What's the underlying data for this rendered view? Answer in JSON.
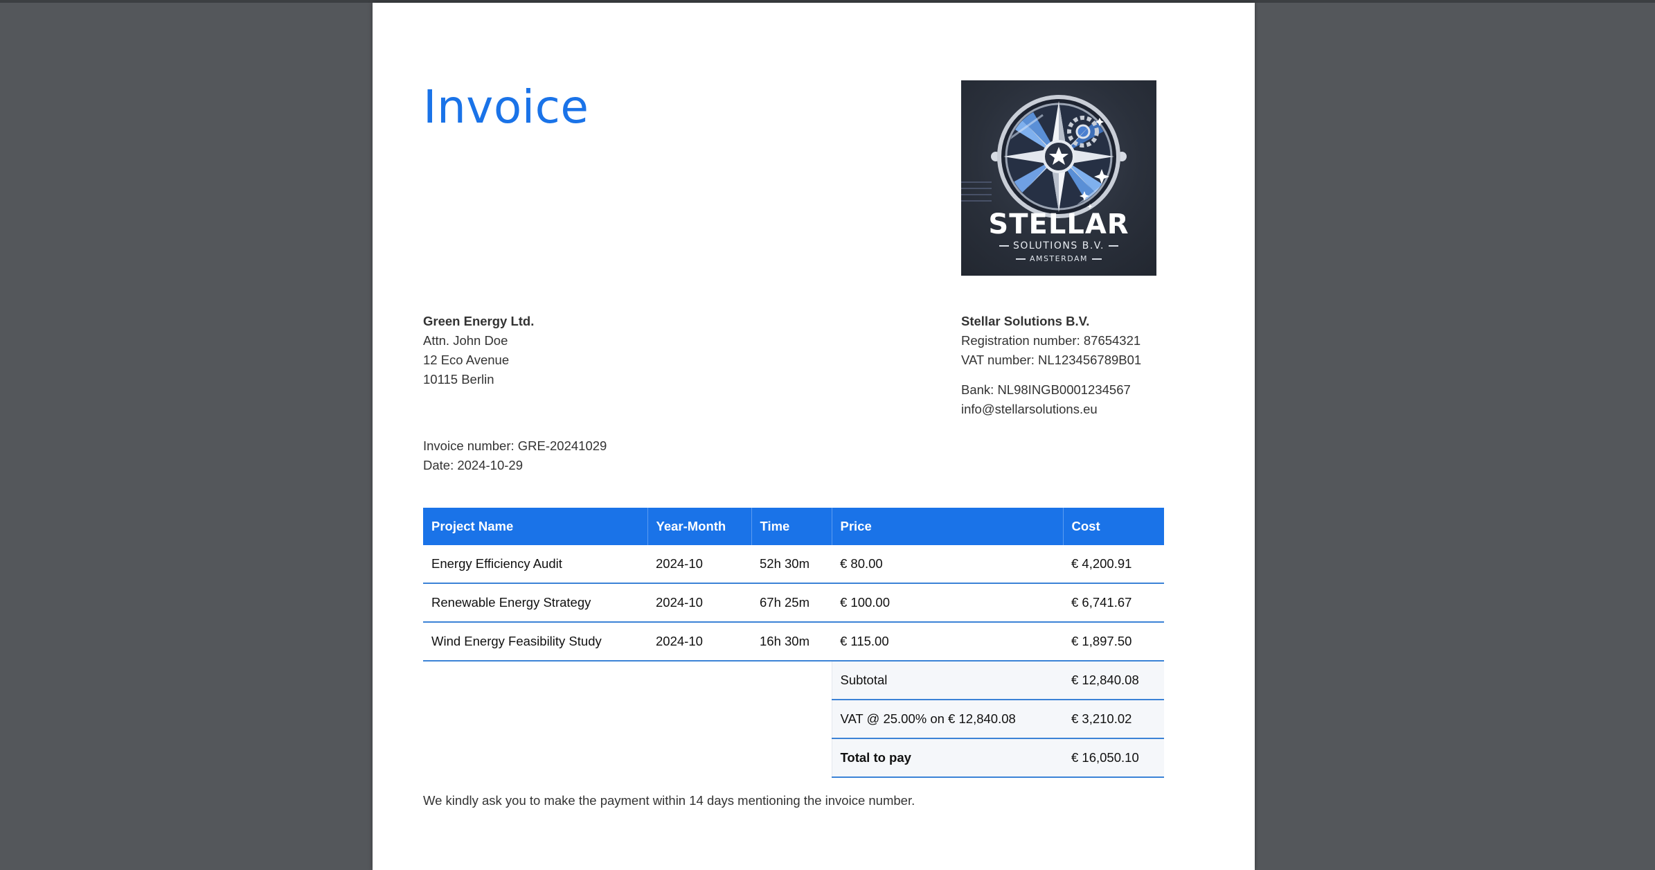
{
  "invoice": {
    "title": "Invoice",
    "number_line": "Invoice number: GRE-20241029",
    "date_line": "Date: 2024-10-29",
    "payment_note": "We kindly ask you to make the payment within 14 days mentioning the invoice number."
  },
  "logo": {
    "name": "STELLAR",
    "subtitle": "SOLUTIONS B.V.",
    "city": "AMSTERDAM"
  },
  "client": {
    "name": "Green Energy Ltd.",
    "attn": "Attn. John Doe",
    "street": "12 Eco Avenue",
    "city": "10115 Berlin"
  },
  "supplier": {
    "name": "Stellar Solutions B.V.",
    "registration": "Registration number: 87654321",
    "vat": "VAT number: NL123456789B01",
    "bank": "Bank: NL98INGB0001234567",
    "email": "info@stellarsolutions.eu"
  },
  "table": {
    "headers": [
      "Project Name",
      "Year-Month",
      "Time",
      "Price",
      "Cost"
    ],
    "rows": [
      [
        "Energy Efficiency Audit",
        "2024-10",
        "52h 30m",
        "€ 80.00",
        "€ 4,200.91"
      ],
      [
        "Renewable Energy Strategy",
        "2024-10",
        "67h 25m",
        "€ 100.00",
        "€ 6,741.67"
      ],
      [
        "Wind Energy Feasibility Study",
        "2024-10",
        "16h 30m",
        "€ 115.00",
        "€ 1,897.50"
      ]
    ],
    "summary": [
      [
        "Subtotal",
        "€ 12,840.08"
      ],
      [
        "VAT @ 25.00% on € 12,840.08",
        "€ 3,210.02"
      ],
      [
        "Total to pay",
        "€ 16,050.10"
      ]
    ]
  },
  "colors": {
    "accent": "#1a73e8",
    "background": "#54575b",
    "logo_bg": "#2a303b"
  }
}
